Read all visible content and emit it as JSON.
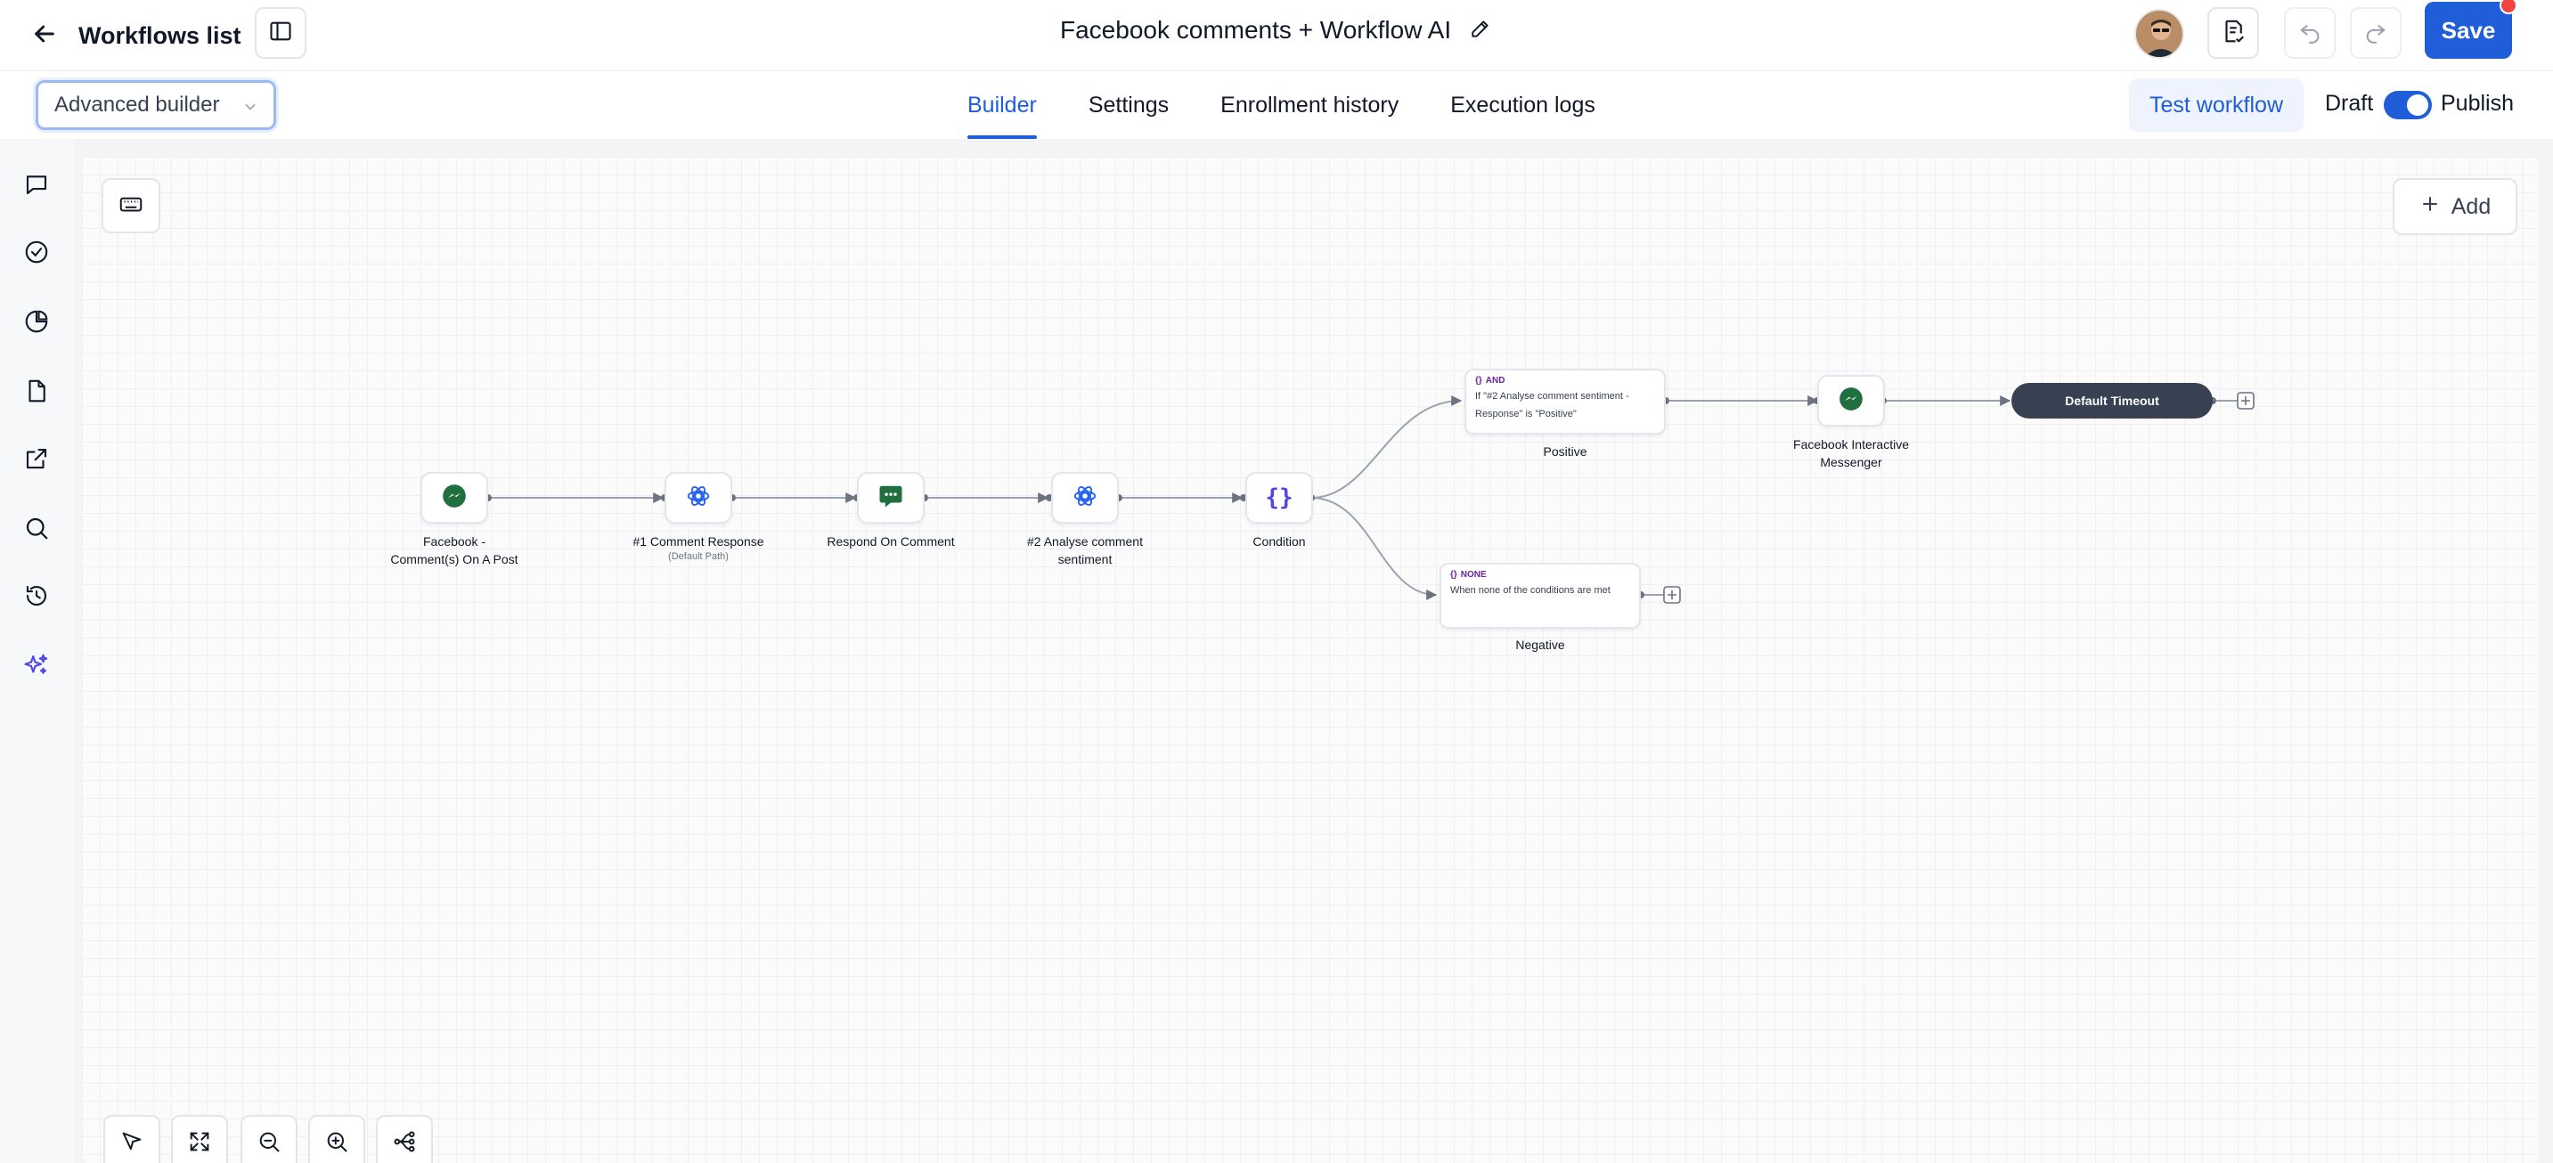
{
  "header": {
    "back_label": "Workflows list",
    "workflow_title": "Facebook comments + Workflow AI",
    "save_label": "Save"
  },
  "subbar": {
    "builder_mode": "Advanced builder",
    "tabs": [
      {
        "label": "Builder",
        "active": true
      },
      {
        "label": "Settings",
        "active": false
      },
      {
        "label": "Enrollment history",
        "active": false
      },
      {
        "label": "Execution logs",
        "active": false
      }
    ],
    "test_label": "Test workflow",
    "draft_label": "Draft",
    "publish_label": "Publish",
    "publish_toggle_on": true
  },
  "rail": {
    "icons": [
      "chat-icon",
      "check-circle-icon",
      "pie-chart-icon",
      "files-icon",
      "external-link-icon",
      "search-icon",
      "history-icon",
      "ai-sparkle-icon"
    ]
  },
  "canvas": {
    "add_label": "Add"
  },
  "nodes": [
    {
      "label": "Facebook -",
      "label2": "Comment(s) On A Post",
      "icon": "messenger-icon"
    },
    {
      "label": "#1 Comment Response",
      "sub": "(Default Path)",
      "icon": "openai-icon"
    },
    {
      "label": "Respond On Comment",
      "icon": "comment-reply-icon"
    },
    {
      "label": "#2 Analyse comment",
      "label2": "sentiment",
      "icon": "openai-icon"
    },
    {
      "label": "Condition",
      "icon": "braces-icon"
    },
    {
      "label": "Facebook Interactive",
      "label2": "Messenger",
      "icon": "messenger-icon"
    }
  ],
  "branches": {
    "positive": {
      "tag": "AND",
      "text1": "If \"#2 Analyse comment sentiment -",
      "text2": "Response\" is \"Positive\"",
      "label": "Positive"
    },
    "negative": {
      "tag": "NONE",
      "text1": "When none of the conditions are met",
      "label": "Negative"
    }
  },
  "timeout_label": "Default Timeout",
  "colors": {
    "accent": "#1f5ed8",
    "messenger_green": "#1f6f3f",
    "openai_blue": "#2563eb",
    "timeout_bg": "#374151"
  }
}
